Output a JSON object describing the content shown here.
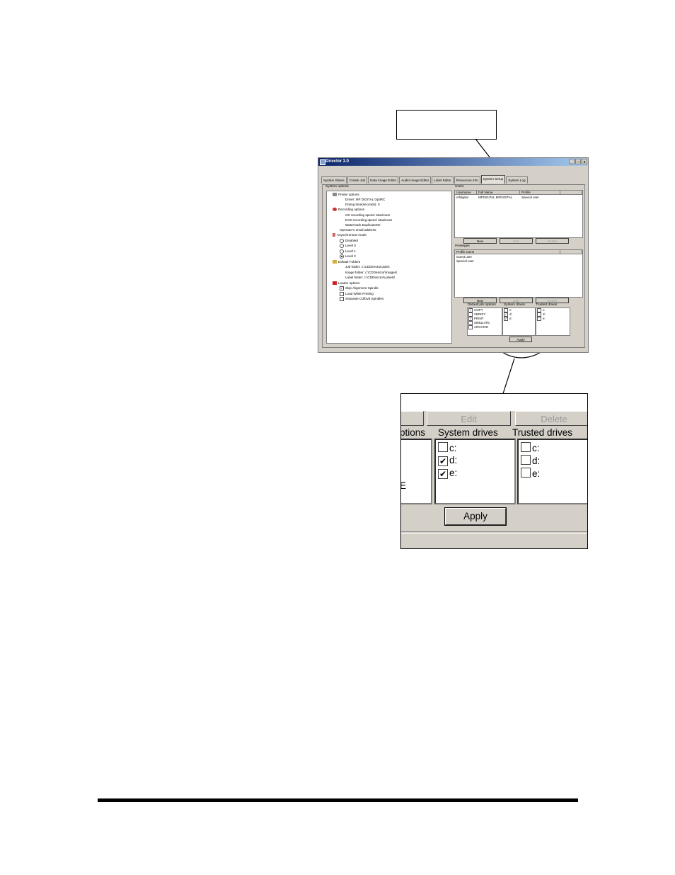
{
  "window": {
    "title": "Director 3.0",
    "min_glyph": "_",
    "max_glyph": "□",
    "close_glyph": "x"
  },
  "tabs": [
    "System Status",
    "Create Job",
    "Data Image Editor",
    "Audio Image Editor",
    "Label Editor",
    "Resources Info",
    "System Setup",
    "System Log"
  ],
  "system_options": {
    "label": "System options",
    "printer_options": "Printer options",
    "driver": "Driver: MF DIGITAL OptiRC",
    "drying_time": "Drying time(seconds): 0",
    "recording_options": "Recording options",
    "cd_speed": "CD recording speed: Maximum",
    "dvd_speed": "DVD recording speed: Maximum",
    "watermark": "Watermark DuplicatorID:",
    "email": "Operator's email address:",
    "async_mode": "Asynchronous mode",
    "disabled": "Disabled",
    "level0": "Level 0",
    "level1": "Level 1",
    "level2": "Level 2",
    "default_folders": "Default Folders",
    "job_folder": "Job folder: c:\\CDDirector\\Jobs\\",
    "image_folder": "Image folder: c:\\CDDirector\\Images\\",
    "label_folder": "Label folder: c:\\CDDirector\\Labels\\",
    "loader_options": "Loader options",
    "skip_alignment": "Skip Alignment Spindle",
    "load_while_printing": "Load While Printing",
    "separate_spindles": "Separate Cd/Dvd Spindles"
  },
  "users": {
    "label": "Users",
    "headers": [
      "Username",
      "Full Name",
      "Profile"
    ],
    "rows": [
      [
        "mfdigital",
        "MFDIGITAL MFDIGITAL",
        "Special user"
      ]
    ],
    "new": "New",
    "edit": "Edit",
    "delete": "Delete"
  },
  "privileges": {
    "label": "Privileges",
    "header": "Profile name",
    "rows": [
      "Guest user",
      "Special user"
    ],
    "new": "New",
    "edit": "Edit",
    "delete": "Delete"
  },
  "job_options": {
    "label": "Default job options",
    "items": [
      "COPY",
      "VERIFY",
      "PRINT",
      "SIMULATE",
      "ARCHIVE"
    ]
  },
  "system_drives": {
    "label": "System drives",
    "items": [
      "c:",
      "d:",
      "e:"
    ]
  },
  "trusted_drives": {
    "label": "Trusted drives",
    "items": [
      "c:",
      "d:",
      "e:"
    ]
  },
  "apply": "Apply",
  "zoom": {
    "edit": "Edit",
    "delete": "Delete",
    "options_partial": "ptions",
    "simulate_partial": "E",
    "system_drives": "System drives",
    "trusted_drives": "Trusted drives",
    "sys_items": [
      "c:",
      "d:",
      "e:"
    ],
    "trust_items": [
      "c:",
      "d:",
      "e:"
    ],
    "apply": "Apply",
    "check_glyph": "✔"
  }
}
